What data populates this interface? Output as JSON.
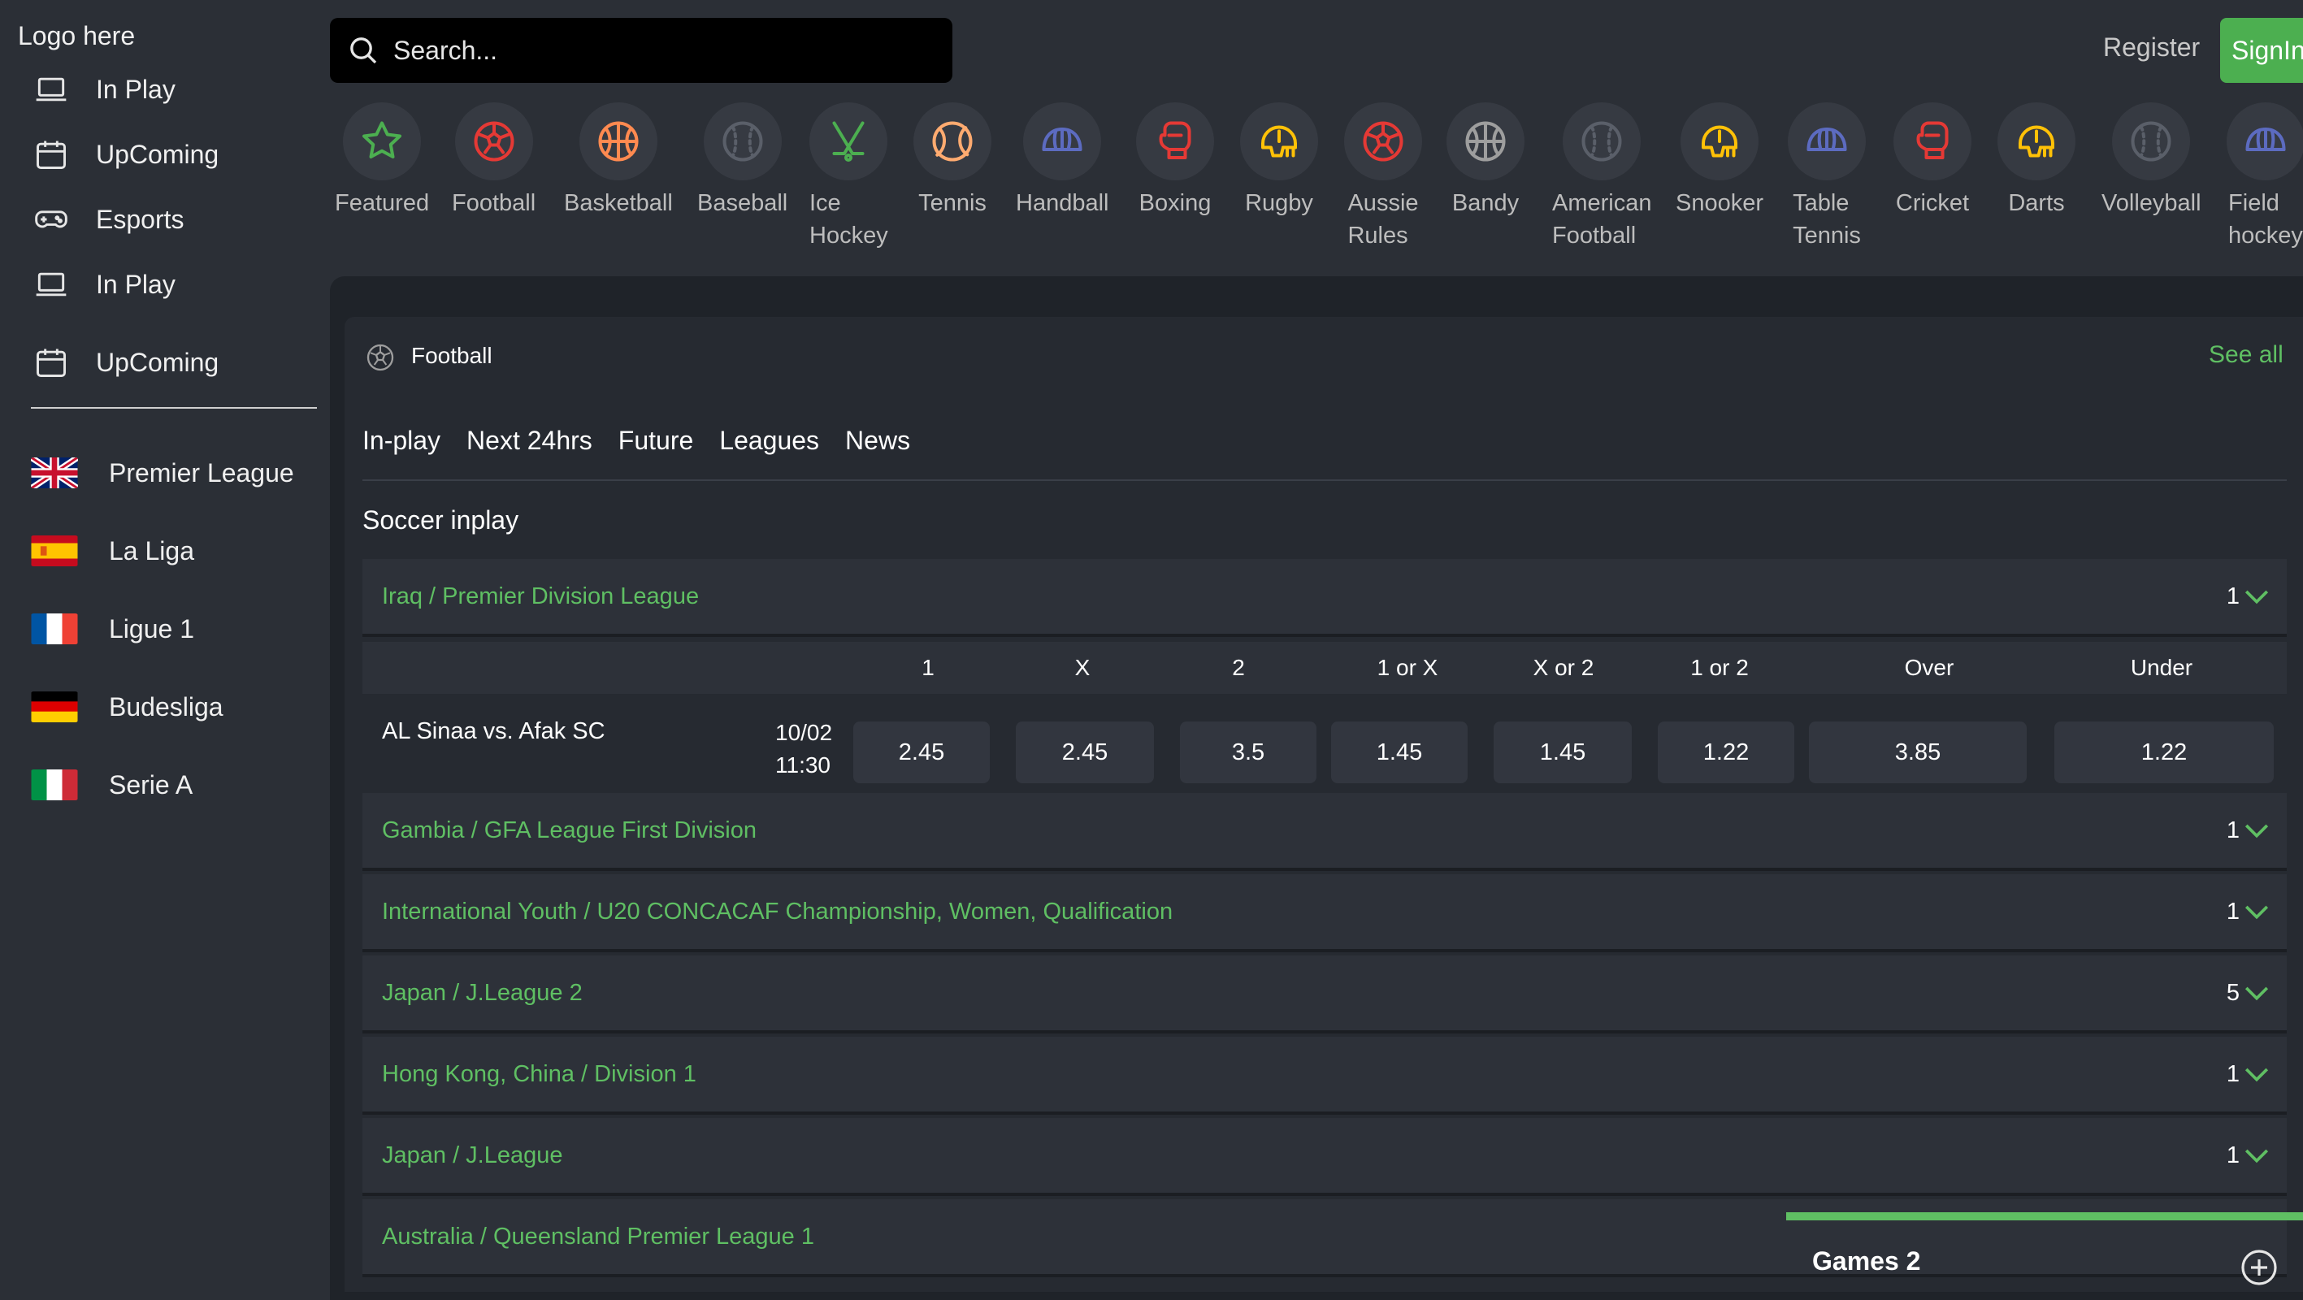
{
  "logo": "Logo here",
  "sidebar": {
    "nav": [
      {
        "label": "In Play",
        "icon": "laptop-icon"
      },
      {
        "label": "UpComing",
        "icon": "calendar-icon"
      },
      {
        "label": "Esports",
        "icon": "gamepad-icon"
      },
      {
        "label": "In Play",
        "icon": "laptop-icon"
      },
      {
        "label": "UpComing",
        "icon": "calendar-icon"
      }
    ],
    "leagues": [
      {
        "label": "Premier League",
        "flag": "uk-flag-icon"
      },
      {
        "label": "La Liga",
        "flag": "spain-flag-icon"
      },
      {
        "label": "Ligue 1",
        "flag": "france-flag-icon"
      },
      {
        "label": "Budesliga",
        "flag": "germany-flag-icon"
      },
      {
        "label": "Serie A",
        "flag": "italy-flag-icon"
      }
    ]
  },
  "header": {
    "search_placeholder": "Search...",
    "register": "Register",
    "signin": "SignIn"
  },
  "sports": [
    {
      "label": "Featured",
      "icon": "star-icon",
      "color": "#4caf50"
    },
    {
      "label": "Football",
      "icon": "soccer-ball-icon",
      "color": "#e53935"
    },
    {
      "label": "Basketball",
      "icon": "basketball-icon",
      "color": "#ff8a50"
    },
    {
      "label": "Baseball",
      "icon": "baseball-icon",
      "color": "#5a5f69"
    },
    {
      "label": "Ice\nHockey",
      "icon": "hockey-sticks-icon",
      "color": "#4caf50"
    },
    {
      "label": "Tennis",
      "icon": "tennis-ball-icon",
      "color": "#ffab70"
    },
    {
      "label": "Handball",
      "icon": "cap-icon",
      "color": "#5c6bc0"
    },
    {
      "label": "Boxing",
      "icon": "boxing-glove-icon",
      "color": "#e53935"
    },
    {
      "label": "Rugby",
      "icon": "helmet-icon",
      "color": "#ffc107"
    },
    {
      "label": "Aussie\nRules",
      "icon": "soccer-ball-icon",
      "color": "#e53935"
    },
    {
      "label": "Bandy",
      "icon": "basketball-icon",
      "color": "#9e9e9e"
    },
    {
      "label": "American\nFootball",
      "icon": "baseball-icon",
      "color": "#5a5f69"
    },
    {
      "label": "Snooker",
      "icon": "helmet-icon",
      "color": "#ffc107"
    },
    {
      "label": "Table\nTennis",
      "icon": "cap-icon",
      "color": "#5c6bc0"
    },
    {
      "label": "Cricket",
      "icon": "boxing-glove-icon",
      "color": "#e53935"
    },
    {
      "label": "Darts",
      "icon": "helmet-icon",
      "color": "#ffc107"
    },
    {
      "label": "Volleyball",
      "icon": "baseball-icon",
      "color": "#5a5f69"
    },
    {
      "label": "Field\nhockey",
      "icon": "cap-icon",
      "color": "#5c6bc0"
    }
  ],
  "panel": {
    "title": "Football",
    "see_all": "See all",
    "tabs": [
      "In-play",
      "Next 24hrs",
      "Future",
      "Leagues",
      "News"
    ],
    "section_title": "Soccer inplay",
    "first_league": {
      "name": "Iraq / Premier Division League",
      "count": "1"
    },
    "odds_headers": [
      "1",
      "X",
      "2",
      "1 or X",
      "X or 2",
      "1 or 2",
      "Over",
      "Under"
    ],
    "match": {
      "name": "AL Sinaa vs. Afak SC",
      "date": "10/02",
      "time": "11:30",
      "odds": [
        "2.45",
        "2.45",
        "3.5",
        "1.45",
        "1.45",
        "1.22",
        "3.85",
        "1.22"
      ]
    },
    "leagues": [
      {
        "name": "Gambia / GFA League First Division",
        "count": "1"
      },
      {
        "name": "International Youth / U20 CONCACAF Championship, Women, Qualification",
        "count": "1"
      },
      {
        "name": "Japan / J.League 2",
        "count": "5"
      },
      {
        "name": "Hong Kong, China / Division 1",
        "count": "1"
      },
      {
        "name": "Japan / J.League",
        "count": "1"
      },
      {
        "name": "Australia / Queensland Premier League 1",
        "count": ""
      }
    ]
  },
  "games_widget": {
    "title": "Games 2"
  },
  "colors": {
    "accent_green": "#4caf50",
    "league_green": "#5fbf63",
    "bg": "#2b2f36"
  }
}
